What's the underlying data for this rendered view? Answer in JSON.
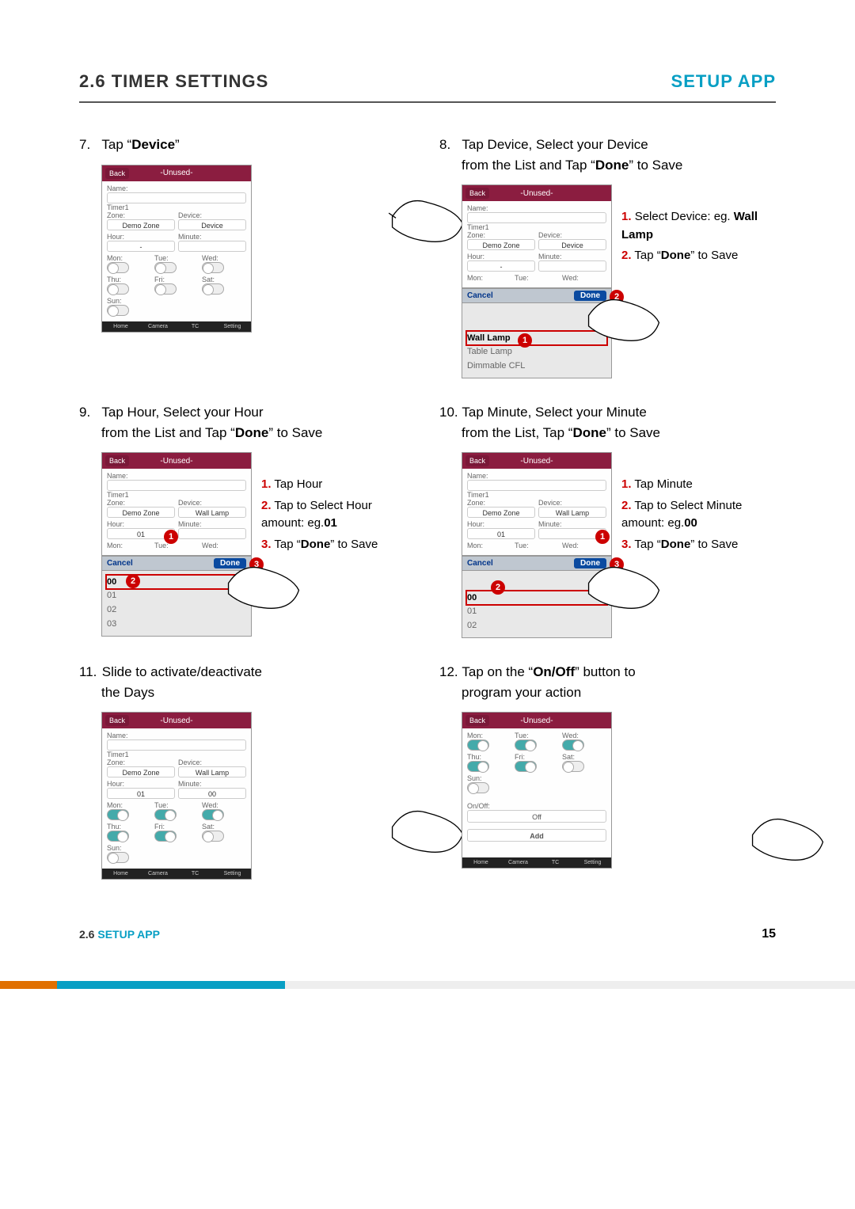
{
  "header": {
    "section_number": "2.6",
    "section_title": "TIMER SETTINGS",
    "right_title": "SETUP APP"
  },
  "footer": {
    "section_number": "2.6",
    "label": "SETUP APP",
    "page_number": "15"
  },
  "step7": {
    "num": "7.",
    "text_pre": "Tap “",
    "text_bold": "Device",
    "text_post": "”",
    "phone": {
      "back": "Back",
      "title": "-Unused-",
      "name_label": "Name:",
      "timer_label": "Timer1",
      "zone_label": "Zone:",
      "zone_val": "Demo Zone",
      "device_label": "Device:",
      "device_val": "Device",
      "hour_label": "Hour:",
      "hour_val": "-",
      "minute_label": "Minute:",
      "minute_val": "",
      "days": [
        "Mon:",
        "Tue:",
        "Wed:",
        "Thu:",
        "Fri:",
        "Sat:",
        "Sun:"
      ],
      "nav": [
        "Home",
        "Camera",
        "TC",
        "Setting"
      ]
    }
  },
  "step8": {
    "num": "8.",
    "line1": "Tap Device, Select your Device",
    "line2_pre": "from the List and Tap “",
    "line2_bold": "Done",
    "line2_post": "” to Save",
    "phone": {
      "back": "Back",
      "title": "-Unused-",
      "name_label": "Name:",
      "timer_label": "Timer1",
      "zone_label": "Zone:",
      "zone_val": "Demo Zone",
      "device_label": "Device:",
      "device_val": "Device",
      "hour_label": "Hour:",
      "hour_val": "-",
      "minute_label": "Minute:",
      "mon": "Mon:",
      "tue": "Tue:",
      "wed": "Wed:",
      "cancel": "Cancel",
      "done": "Done",
      "items": [
        "Wall Lamp",
        "Table Lamp",
        "Dimmable CFL"
      ]
    },
    "callouts": [
      {
        "n": "1.",
        "text_pre": "Select Device: eg. ",
        "bold": "Wall Lamp",
        "post": ""
      },
      {
        "n": "2.",
        "text_pre": "Tap “",
        "bold": "Done",
        "post": "” to Save"
      }
    ]
  },
  "step9": {
    "num": "9.",
    "line1": "Tap Hour, Select your Hour",
    "line2_pre": "from the List and Tap “",
    "line2_bold": "Done",
    "line2_post": "” to Save",
    "phone": {
      "back": "Back",
      "title": "-Unused-",
      "name_label": "Name:",
      "timer_label": "Timer1",
      "zone_label": "Zone:",
      "zone_val": "Demo Zone",
      "device_label": "Device:",
      "device_val": "Wall Lamp",
      "hour_label": "Hour:",
      "hour_val": "01",
      "minute_label": "Minute:",
      "mon": "Mon:",
      "tue": "Tue:",
      "wed": "Wed:",
      "cancel": "Cancel",
      "done": "Done",
      "items": [
        "00",
        "01",
        "02",
        "03"
      ]
    },
    "callouts": [
      {
        "n": "1.",
        "text": "Tap Hour"
      },
      {
        "n": "2.",
        "text_pre": "Tap to Select Hour amount: eg.",
        "bold": "01"
      },
      {
        "n": "3.",
        "text_pre": "Tap “",
        "bold": "Done",
        "post": "” to Save"
      }
    ]
  },
  "step10": {
    "num": "10.",
    "line1": "Tap Minute, Select  your Minute",
    "line2_pre": "from the List, Tap “",
    "line2_bold": "Done",
    "line2_post": "” to Save",
    "phone": {
      "back": "Back",
      "title": "-Unused-",
      "name_label": "Name:",
      "timer_label": "Timer1",
      "zone_label": "Zone:",
      "zone_val": "Demo Zone",
      "device_label": "Device:",
      "device_val": "Wall Lamp",
      "hour_label": "Hour:",
      "hour_val": "01",
      "minute_label": "Minute:",
      "mon": "Mon:",
      "tue": "Tue:",
      "wed": "Wed:",
      "cancel": "Cancel",
      "done": "Done",
      "items": [
        "00",
        "01",
        "02"
      ]
    },
    "callouts": [
      {
        "n": "1.",
        "text": "Tap Minute"
      },
      {
        "n": "2.",
        "text_pre": "Tap to Select Minute amount: eg.",
        "bold": "00"
      },
      {
        "n": "3.",
        "text_pre": "Tap “",
        "bold": "Done",
        "post": "” to Save"
      }
    ]
  },
  "step11": {
    "num": "11.",
    "line1": "Slide to activate/deactivate",
    "line2": "the Days",
    "phone": {
      "back": "Back",
      "title": "-Unused-",
      "name_label": "Name:",
      "timer_label": "Timer1",
      "zone_label": "Zone:",
      "zone_val": "Demo Zone",
      "device_label": "Device:",
      "device_val": "Wall Lamp",
      "hour_label": "Hour:",
      "hour_val": "01",
      "minute_label": "Minute:",
      "minute_val": "00",
      "days": [
        {
          "label": "Mon:",
          "on": true
        },
        {
          "label": "Tue:",
          "on": true
        },
        {
          "label": "Wed:",
          "on": true
        },
        {
          "label": "Thu:",
          "on": true
        },
        {
          "label": "Fri:",
          "on": true
        },
        {
          "label": "Sat:",
          "on": false
        },
        {
          "label": "Sun:",
          "on": false
        }
      ],
      "nav": [
        "Home",
        "Camera",
        "TC",
        "Setting"
      ]
    }
  },
  "step12": {
    "num": "12.",
    "line1_pre": "Tap on the “",
    "line1_bold": "On/Off",
    "line1_post": "” button to",
    "line2": "program your action",
    "phone": {
      "back": "Back",
      "title": "-Unused-",
      "days": [
        {
          "label": "Mon:",
          "on": true
        },
        {
          "label": "Tue:",
          "on": true
        },
        {
          "label": "Wed:",
          "on": true
        },
        {
          "label": "Thu:",
          "on": true
        },
        {
          "label": "Fri:",
          "on": true
        },
        {
          "label": "Sat:",
          "on": false
        },
        {
          "label": "Sun:",
          "on": false
        }
      ],
      "onoff_label": "On/Off:",
      "onoff_val": "Off",
      "add": "Add",
      "nav": [
        "Home",
        "Camera",
        "TC",
        "Setting"
      ]
    }
  }
}
